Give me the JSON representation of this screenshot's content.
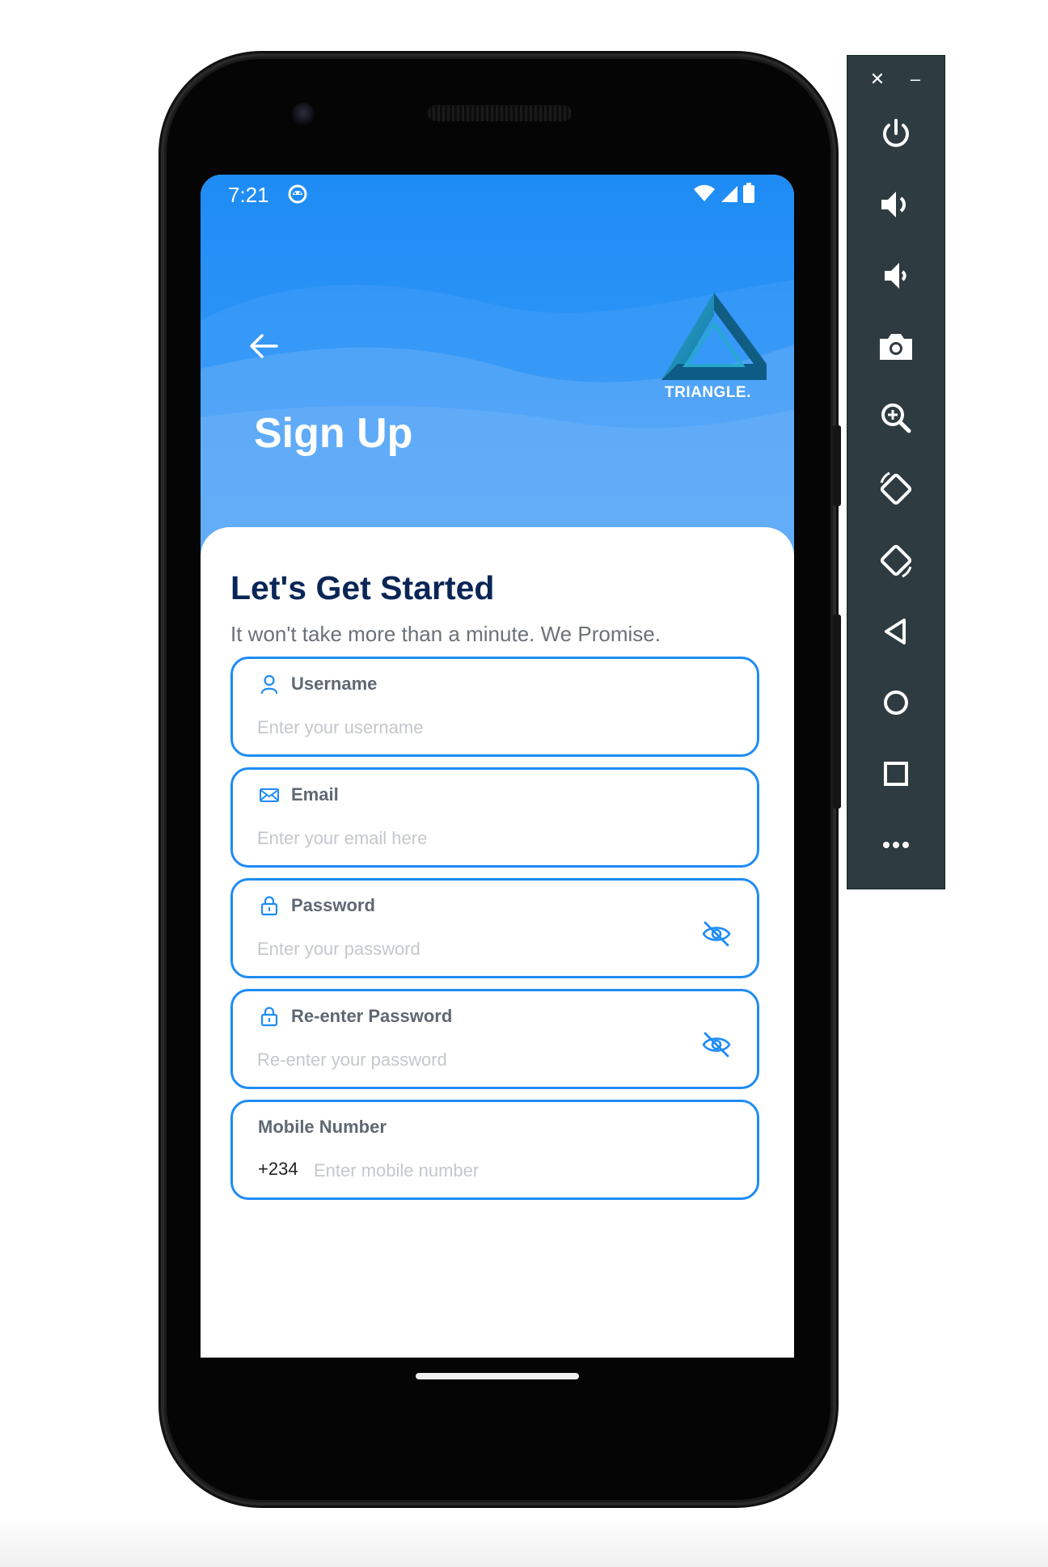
{
  "status_bar": {
    "time": "7:21"
  },
  "header": {
    "title": "Sign Up",
    "logo_text": "TRIANGLE."
  },
  "card": {
    "heading": "Let's Get Started",
    "subtitle": "It won't take more than a minute. We Promise."
  },
  "form": {
    "username": {
      "label": "Username",
      "placeholder": "Enter your username",
      "value": ""
    },
    "email": {
      "label": "Email",
      "placeholder": "Enter your email here",
      "value": ""
    },
    "password": {
      "label": "Password",
      "placeholder": "Enter your password",
      "value": ""
    },
    "reenter_password": {
      "label": "Re-enter Password",
      "placeholder": "Re-enter your password",
      "value": ""
    },
    "mobile": {
      "label": "Mobile Number",
      "prefix": "+234",
      "placeholder": "Enter mobile number",
      "value": ""
    }
  },
  "icons": {
    "notification": "android-notification-icon",
    "wifi": "wifi-icon",
    "cellular": "signal-icon",
    "battery": "battery-icon",
    "back": "arrow-left-icon",
    "user": "user-icon",
    "mail": "mail-icon",
    "lock": "lock-icon",
    "eye_off": "eye-off-icon"
  },
  "emulator_toolbar": {
    "close_label": "✕",
    "minimize_label": "–",
    "buttons": [
      "power",
      "volume-up",
      "volume-down",
      "screenshot",
      "zoom",
      "rotate-left",
      "rotate-right",
      "back",
      "home",
      "overview",
      "more"
    ]
  },
  "colors": {
    "primary": "#1e8cf5",
    "heading": "#0a2657",
    "toolbar_bg": "#2e3b40"
  }
}
